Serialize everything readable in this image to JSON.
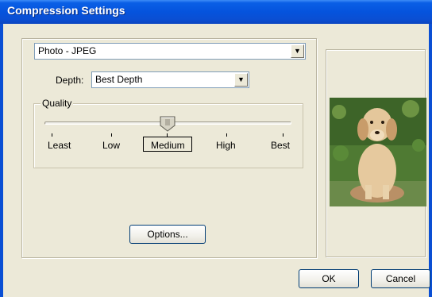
{
  "window": {
    "title": "Compression Settings"
  },
  "codec": {
    "selected": "Photo - JPEG"
  },
  "depth": {
    "label": "Depth:",
    "selected": "Best Depth"
  },
  "quality": {
    "legend": "Quality",
    "ticks": [
      "Least",
      "Low",
      "Medium",
      "High",
      "Best"
    ],
    "selected": "Medium",
    "level": 0.5
  },
  "buttons": {
    "options": "Options...",
    "ok": "OK",
    "cancel": "Cancel"
  },
  "preview": {
    "subject": "golden-retriever-photo"
  },
  "colors": {
    "title_bar": "#0553dd",
    "dialog_bg": "#ece9d8",
    "input_border": "#7f9db9"
  }
}
